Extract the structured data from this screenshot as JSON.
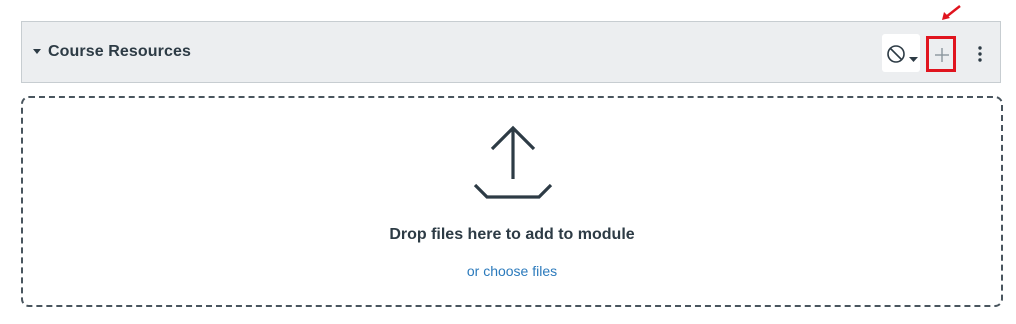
{
  "module": {
    "title": "Course Resources",
    "publish_state_icon": "ban-icon",
    "add_item_icon": "plus-icon",
    "menu_icon": "kebab-menu-icon"
  },
  "drop_zone": {
    "message": "Drop files here to add to module",
    "choose_link": "or choose files",
    "icon": "upload-icon"
  },
  "colors": {
    "header_bg": "#eceef0",
    "text": "#2d3b45",
    "link": "#2b7abc",
    "highlight": "#e0141e"
  }
}
